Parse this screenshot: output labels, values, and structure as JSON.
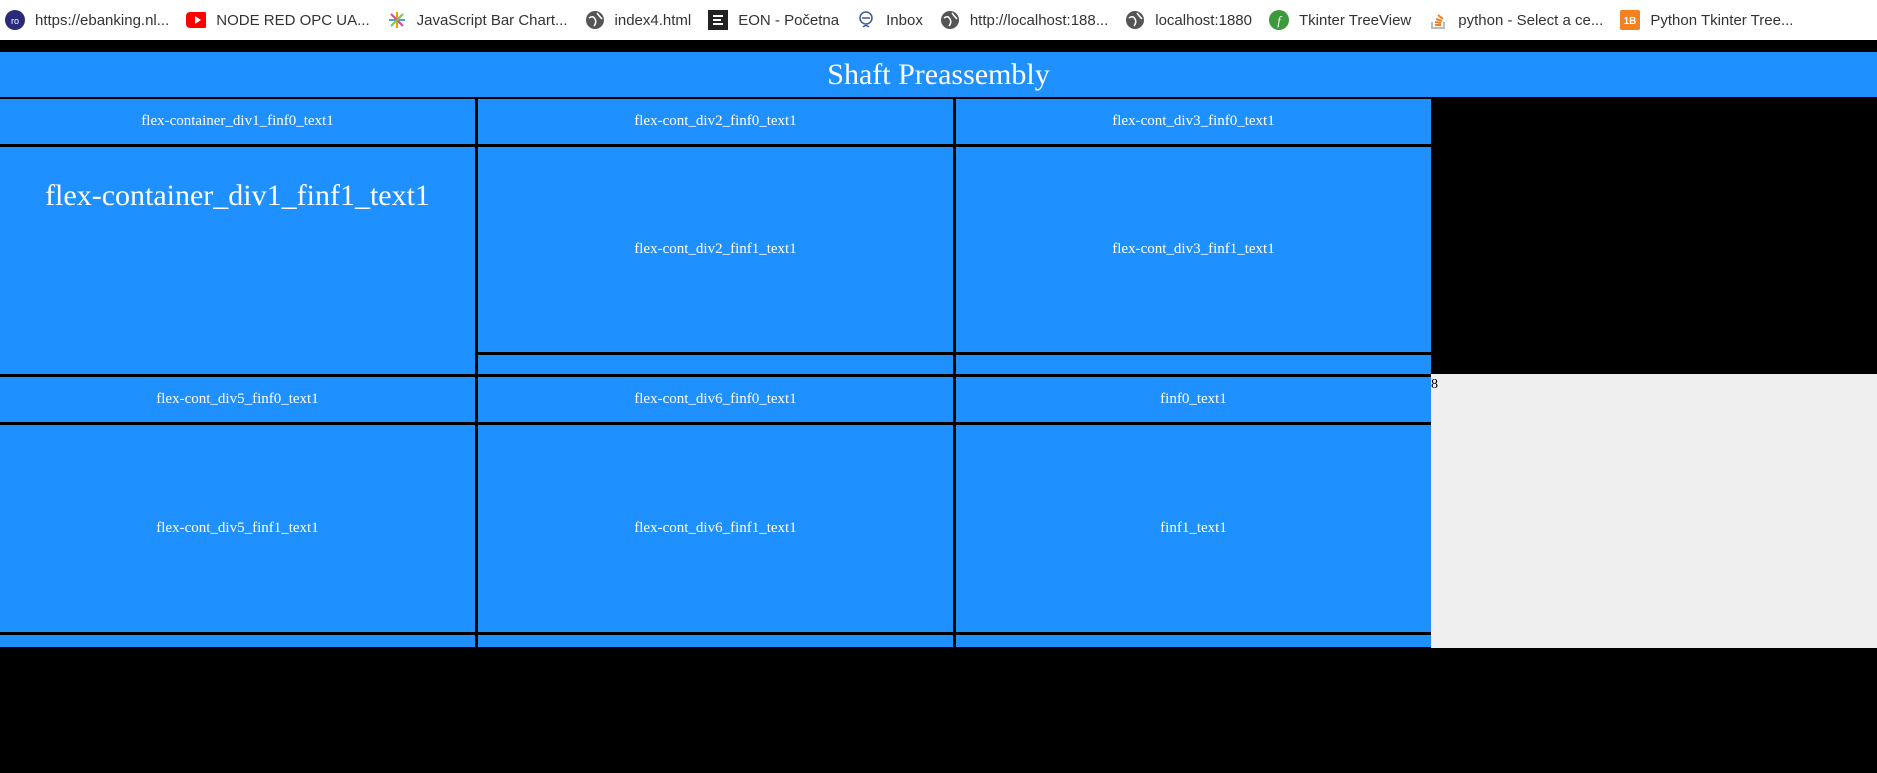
{
  "bookmarks": [
    {
      "label": "https://ebanking.nl...",
      "icon": "bank-icon",
      "color": "#2b2a7a"
    },
    {
      "label": "NODE RED OPC UA...",
      "icon": "youtube-icon",
      "color": "#ff0000"
    },
    {
      "label": "JavaScript Bar Chart...",
      "icon": "sparkle-icon",
      "color": "#e8a400"
    },
    {
      "label": "index4.html",
      "icon": "globe-icon",
      "color": "#555555"
    },
    {
      "label": "EON - Početna",
      "icon": "eon-icon",
      "color": "#222222"
    },
    {
      "label": "Inbox",
      "icon": "mail-icon",
      "color": "#3b5998"
    },
    {
      "label": "http://localhost:188...",
      "icon": "globe-icon",
      "color": "#555555"
    },
    {
      "label": "localhost:1880",
      "icon": "globe-icon",
      "color": "#555555"
    },
    {
      "label": "Tkinter TreeView",
      "icon": "leaf-icon",
      "color": "#3c9a3c"
    },
    {
      "label": "python - Select a ce...",
      "icon": "stackoverflow-icon",
      "color": "#f48024"
    },
    {
      "label": "Python Tkinter Tree...",
      "icon": "tutorial-icon",
      "color": "#f4801f"
    }
  ],
  "header": {
    "title": "Shaft Preassembly"
  },
  "row1": {
    "div1": {
      "finf0": "flex-container_div1_finf0_text1",
      "finf1": "flex-container_div1_finf1_text1"
    },
    "div2": {
      "finf0": "flex-cont_div2_finf0_text1",
      "finf1": "flex-cont_div2_finf1_text1"
    },
    "div3": {
      "finf0": "flex-cont_div3_finf0_text1",
      "finf1": "flex-cont_div3_finf1_text1"
    }
  },
  "row2": {
    "div5": {
      "finf0": "flex-cont_div5_finf0_text1",
      "finf1": "flex-cont_div5_finf1_text1"
    },
    "div6": {
      "finf0": "flex-cont_div6_finf0_text1",
      "finf1": "flex-cont_div6_finf1_text1"
    },
    "div7": {
      "finf0": "finf0_text1",
      "finf1": "finf1_text1"
    }
  },
  "stray_number": "8",
  "colors": {
    "panel": "#1e90ff",
    "background": "#000000",
    "empty_area": "#efefef"
  }
}
